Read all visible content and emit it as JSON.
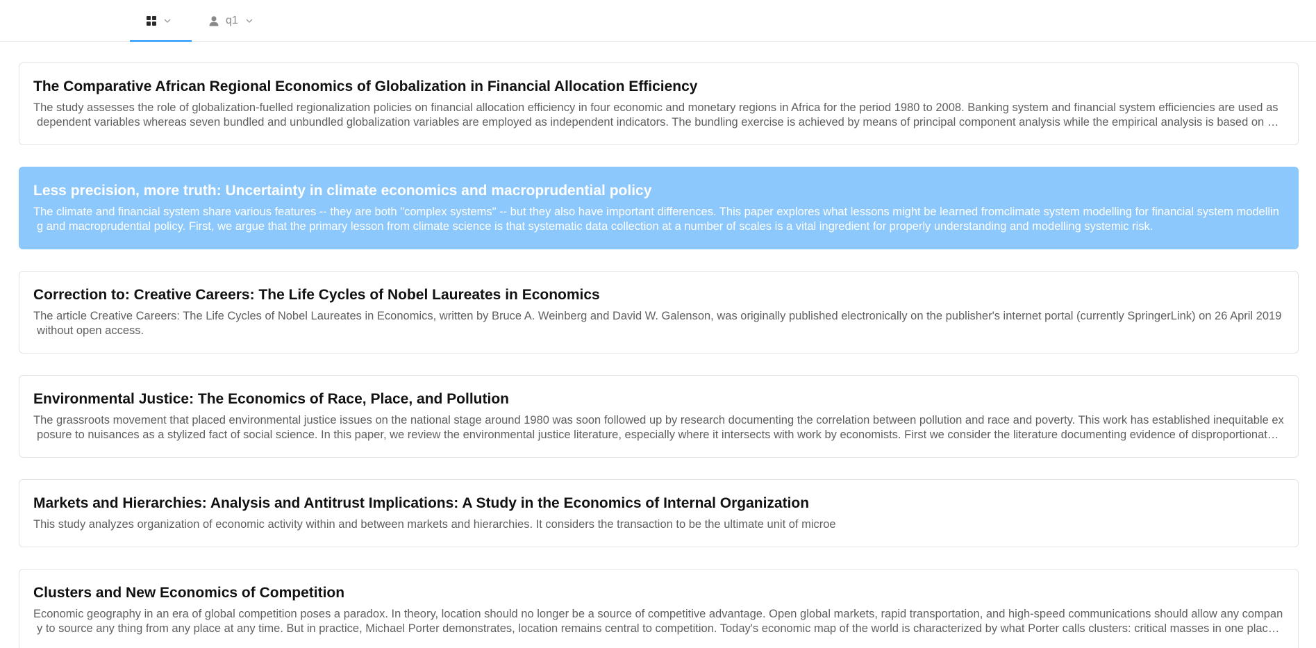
{
  "header": {
    "tabs": [
      {
        "icon": "grid-icon",
        "dropdown_icon": "chevron-down-icon",
        "active": true
      },
      {
        "icon": "user-icon",
        "label": "q1",
        "dropdown_icon": "chevron-down-icon",
        "active": false
      }
    ],
    "accent_color": "#1890ff"
  },
  "selected_color": "#8cc8fc",
  "papers": [
    {
      "title": "The Comparative African Regional Economics of Globalization in Financial Allocation Efficiency",
      "abstract": " The study assesses the role of globalization-fuelled regionalization policies on financial allocation efficiency in four economic and monetary regions in Africa for the period 1980 to 2008. Banking system and financial system efficiencies are used as dependent variables whereas seven bundled and unbundled globalization variables are employed as independent indicators. The bundling exercise is achieved by means of principal component analysis while the empirical analysis is based on panel fixed effects and system generalized method of moments estimators."
    },
    {
      "title": "Less precision, more truth: Uncertainty in climate economics and macroprudential policy",
      "abstract": " The climate and financial system share various features -- they are both \"complex systems\" -- but they also have important differences. This paper explores what lessons might be learned fromclimate system modelling for financial system modelling and macroprudential policy. First, we argue that the primary lesson from climate science is that systematic data collection at a number of scales is a vital ingredient for properly understanding and modelling systemic risk.",
      "selected": true
    },
    {
      "title": "Correction to: Creative Careers: The Life Cycles of Nobel Laureates in Economics",
      "abstract": " The article Creative Careers: The Life Cycles of Nobel Laureates in Economics, written by Bruce A. Weinberg and David W. Galenson, was originally published electronically on the publisher's internet portal (currently SpringerLink) on 26 April 2019 without open access."
    },
    {
      "title": "Environmental Justice: The Economics of Race, Place, and Pollution",
      "abstract": " The grassroots movement that placed environmental justice issues on the national stage around 1980 was soon followed up by research documenting the correlation between pollution and race and poverty. This work has established inequitable exposure to nuisances as a stylized fact of social science. In this paper, we review the environmental justice literature, especially where it intersects with work by economists. First we consider the literature documenting evidence of disproportionate exposure."
    },
    {
      "title": "Markets and Hierarchies: Analysis and Antitrust Implications: A Study in the Economics of Internal Organization",
      "abstract": " This study analyzes organization of economic activity within and between markets and hierarchies. It considers the transaction to be the ultimate unit of microe"
    },
    {
      "title": "Clusters and New Economics of Competition",
      "abstract": " Economic geography in an era of global competition poses a paradox. In theory, location should no longer be a source of competitive advantage. Open global markets, rapid transportation, and high-speed communications should allow any company to source any thing from any place at any time. But in practice, Michael Porter demonstrates, location remains central to competition. Today's economic map of the world is characterized by what Porter calls clusters: critical masses in one place of linked industries and institutions."
    }
  ]
}
